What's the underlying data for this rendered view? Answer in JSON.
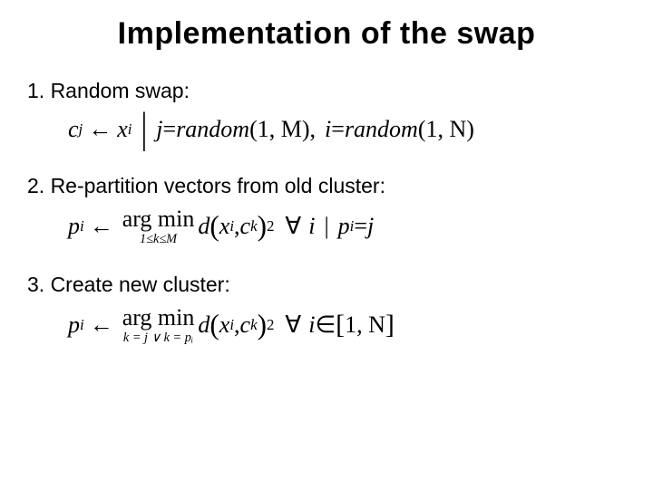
{
  "title": "Implementation of the swap",
  "steps": {
    "s1": {
      "label": "1. Random swap:",
      "f": {
        "lhs_var": "c",
        "lhs_sub": "j",
        "rhs_var": "x",
        "rhs_sub": "i",
        "cond_j_lead": "j",
        "cond_j_eq": " = ",
        "cond_j_fn": "random",
        "cond_j_args": "(1, M)",
        "comma": ",",
        "cond_i_lead": "i",
        "cond_i_eq": " = ",
        "cond_i_fn": "random",
        "cond_i_args": "(1, N)"
      }
    },
    "s2": {
      "label": "2. Re-partition vectors from old cluster:",
      "f": {
        "lhs_var": "p",
        "lhs_sub": "i",
        "argmin_top": "arg min",
        "argmin_bot": "1≤k≤M",
        "d": "d",
        "arg_x": "x",
        "arg_x_sub": "i",
        "arg_sep": " , ",
        "arg_c": "c",
        "arg_c_sub": "k",
        "power": "2",
        "cond_lead": "i",
        "cond_bar": " | ",
        "cond_var": "p",
        "cond_sub": "i",
        "cond_eq": " = ",
        "cond_rhs": "j"
      }
    },
    "s3": {
      "label": "3. Create new cluster:",
      "f": {
        "lhs_var": "p",
        "lhs_sub": "i",
        "argmin_top": "arg min",
        "argmin_bot": "k = j ∨ k = pᵢ",
        "d": "d",
        "arg_x": "x",
        "arg_x_sub": "i",
        "arg_sep": " , ",
        "arg_c": "c",
        "arg_c_sub": "k",
        "power": "2",
        "cond_lead": "i",
        "cond_in": " ∈ ",
        "range_l": "[",
        "range_a": "1, N",
        "range_r": "]"
      }
    }
  }
}
